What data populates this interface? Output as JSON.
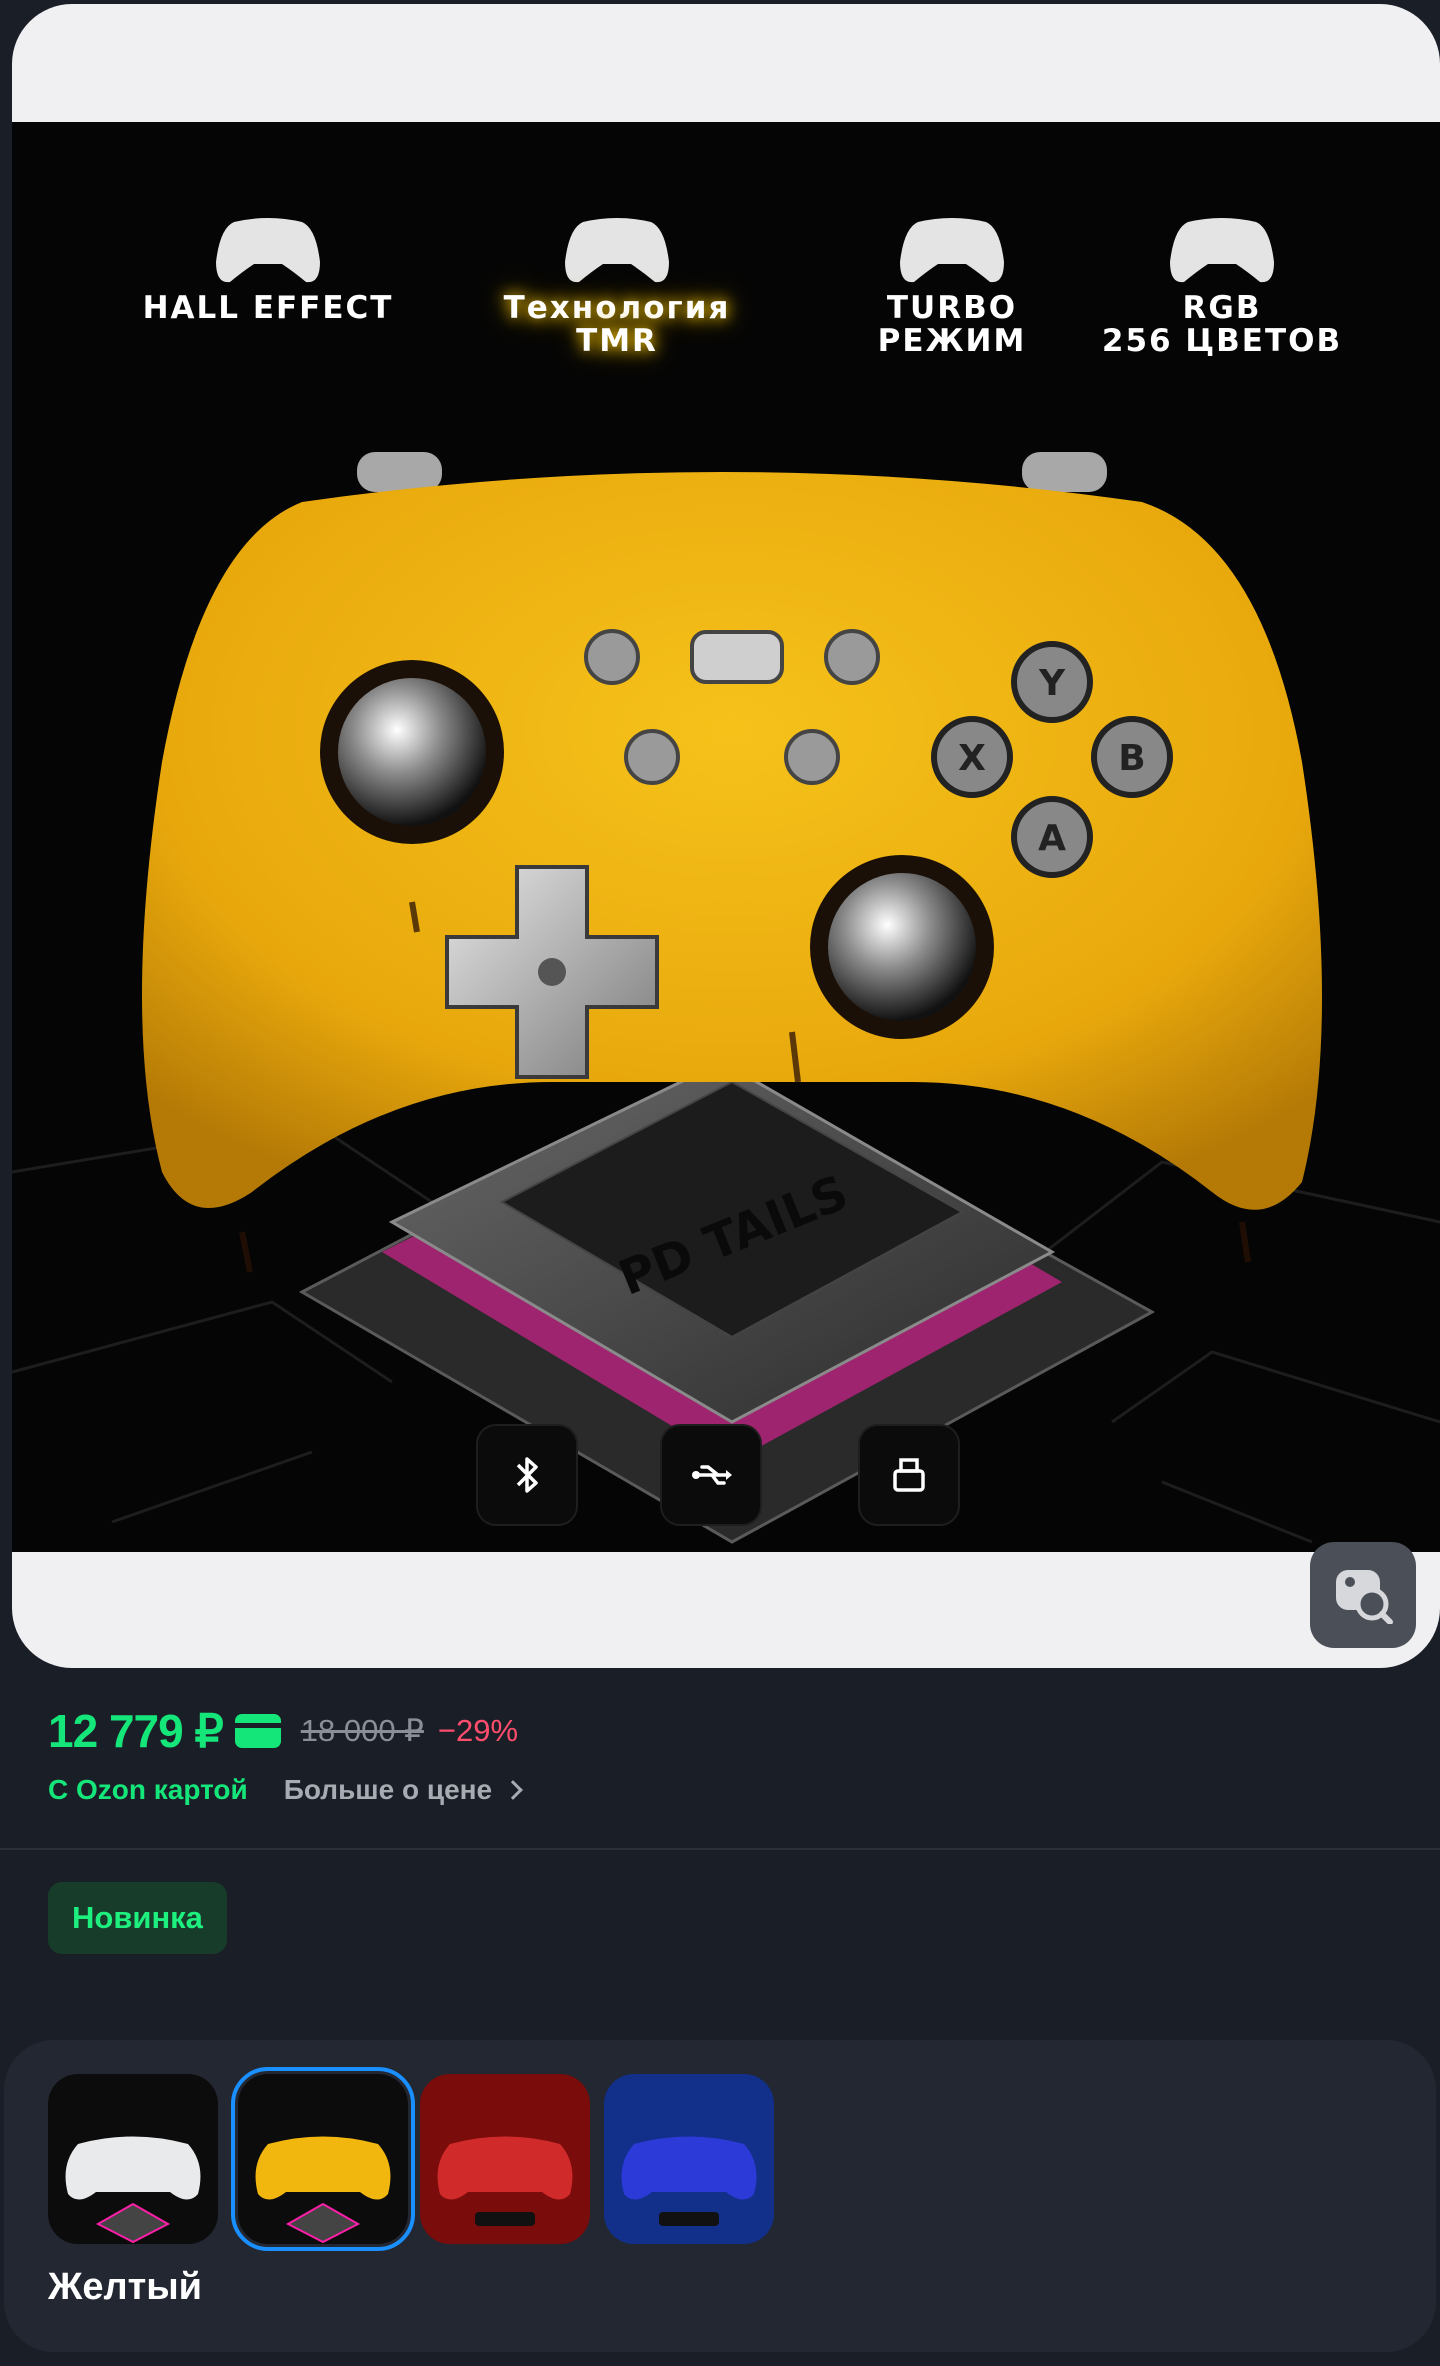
{
  "hero": {
    "features": [
      {
        "label": "HALL EFFECT",
        "icon": "gamepad-icon"
      },
      {
        "label": "Технология TMR",
        "icon": "gamepad-icon",
        "highlight": true
      },
      {
        "label": "TURBO\nРЕЖИМ",
        "icon": "gamepad-icon"
      },
      {
        "label": "RGB\n256 ЦВЕТОВ",
        "icon": "gamepad-icon"
      }
    ],
    "chip_text": "PD TAILS",
    "face_buttons": [
      "Y",
      "X",
      "B",
      "A"
    ],
    "connectivity": [
      "bluetooth-icon",
      "usb-icon",
      "dongle-icon"
    ],
    "colors": {
      "controller": "#f2b70f",
      "glow": "#ff1fa8",
      "background": "#050505"
    }
  },
  "image_search": {
    "icon": "image-search-icon"
  },
  "price": {
    "current": "12 779 ₽",
    "old": "18 000 ₽",
    "discount": "−29%",
    "with_card": "С Ozon картой",
    "more": "Больше о цене"
  },
  "badge": {
    "label": "Новинка"
  },
  "variants": {
    "selected_name": "Желтый",
    "items": [
      {
        "color": "white",
        "tint": "#e9eaec",
        "bg": "#0c0c0c"
      },
      {
        "color": "yellow",
        "tint": "#f2b70f",
        "bg": "#0c0c0c",
        "selected": true
      },
      {
        "color": "red",
        "tint": "#d12a2a",
        "bg": "#7a0c0c"
      },
      {
        "color": "blue",
        "tint": "#2c3ad8",
        "bg": "#12308a"
      }
    ]
  },
  "colors": {
    "accent": "#15e67a",
    "discount": "#ff4d6d",
    "selected_outline": "#1a8fff"
  }
}
